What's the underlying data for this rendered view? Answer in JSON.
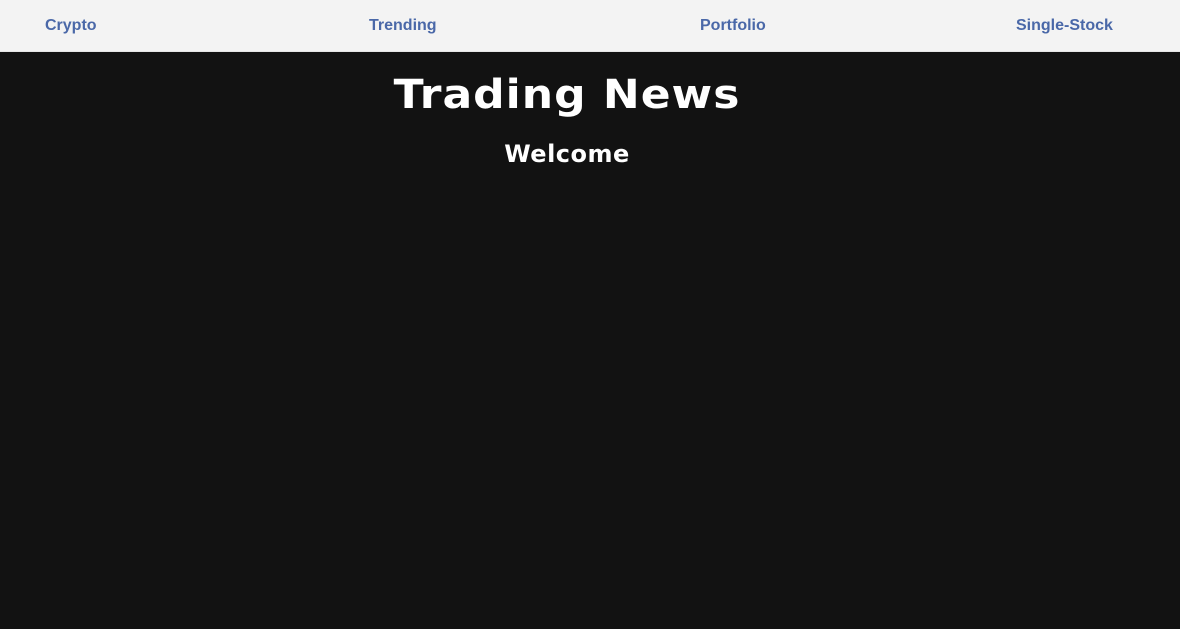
{
  "navbar": {
    "links": [
      {
        "label": "Crypto"
      },
      {
        "label": "Trending"
      },
      {
        "label": "Portfolio"
      },
      {
        "label": "Single-Stock"
      }
    ]
  },
  "main": {
    "title": "Trading News",
    "subtitle": "Welcome"
  },
  "colors": {
    "navbar_bg": "#f3f3f3",
    "nav_link": "#4a68a8",
    "page_bg": "#121212",
    "heading": "#ffffff"
  }
}
